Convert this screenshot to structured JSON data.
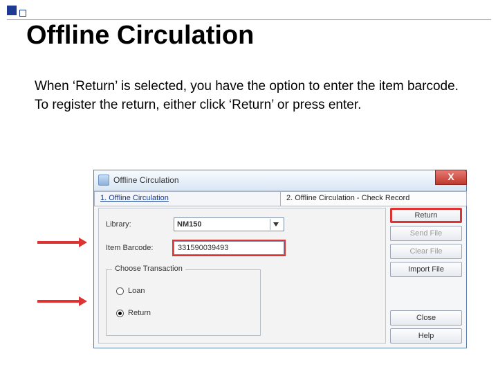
{
  "slide": {
    "title": "Offline Circulation",
    "body": "When ‘Return’ is selected, you have the option to enter the item barcode.  To register the return, either click ‘Return’ or press enter."
  },
  "window": {
    "title": "Offline Circulation",
    "tabs": {
      "t1": "1. Offline Circulation",
      "t2": "2. Offline Circulation - Check Record"
    },
    "labels": {
      "library": "Library:",
      "barcode": "Item Barcode:",
      "group": "Choose Transaction"
    },
    "values": {
      "library": "NM150",
      "barcode": "331590039493"
    },
    "radios": {
      "loan": "Loan",
      "return": "Return"
    },
    "buttons": {
      "return": "Return",
      "send": "Send File",
      "clear": "Clear File",
      "import": "Import File",
      "close": "Close",
      "help": "Help"
    }
  }
}
